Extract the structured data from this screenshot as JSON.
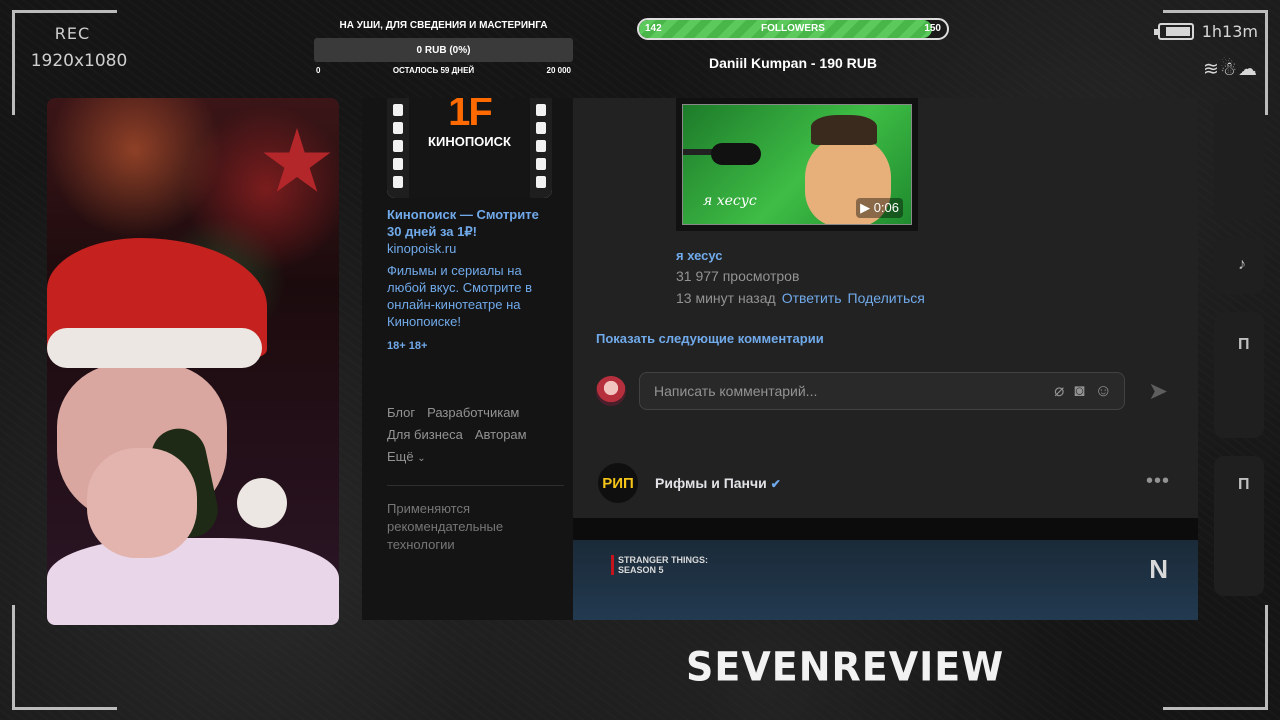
{
  "overlay": {
    "rec_label": "REC",
    "resolution": "1920x1080",
    "uptime": "1h13m",
    "weather_icons": "wind-icon snowman-icon cloud-icon",
    "brand": "SEVENREVIEW",
    "battery_level": 0.85
  },
  "goal": {
    "title": "НА УШИ, ДЛЯ СВЕДЕНИЯ И МАСТЕРИНГА",
    "progress_text": "0 RUB (0%)",
    "progress": 0,
    "min": "0",
    "remaining": "ОСТАЛОСЬ 59 ДНЕЙ",
    "max": "20 000",
    "fill_color": "#4caf50"
  },
  "followers": {
    "current": "142",
    "label": "FOLLOWERS",
    "target": "150",
    "progress": 0.95,
    "bar_color": "#5cc95c"
  },
  "last_donation": "Daniil Kumpan - 190 RUB",
  "browser": {
    "ad": {
      "logo_text": "КИНОПОИСК",
      "logo_mark": "1F",
      "title": "Кинопоиск — Смотрите 30 дней за 1₽!",
      "domain": "kinopoisk.ru",
      "description": "Фильмы и сериалы на любой вкус. Смотрите в онлайн-кинотеатре на Кинопоиске!",
      "age": "18+ 18+"
    },
    "footer_links": [
      "Блог",
      "Разработчикам",
      "Для бизнеса",
      "Авторам",
      "Ещё"
    ],
    "recommendation_note": "Применяются рекомендательные технологии",
    "comment": {
      "video_caption": "я хесус",
      "duration": "0:06",
      "title": "я хесус",
      "views": "31 977 просмотров",
      "time": "13 минут назад",
      "reply": "Ответить",
      "share": "Поделиться"
    },
    "more_comments": "Показать следующие комментарии",
    "comment_input_placeholder": "Написать комментарий...",
    "post": {
      "author": "Рифмы и Панчи",
      "avatar_text": "РИП",
      "image_title_line1": "STRANGER THINGS:",
      "image_title_line2": "SEASON 5",
      "image_brand": "N"
    },
    "accent_color": "#71aaeb"
  },
  "side_cards": [
    "П",
    "П"
  ]
}
